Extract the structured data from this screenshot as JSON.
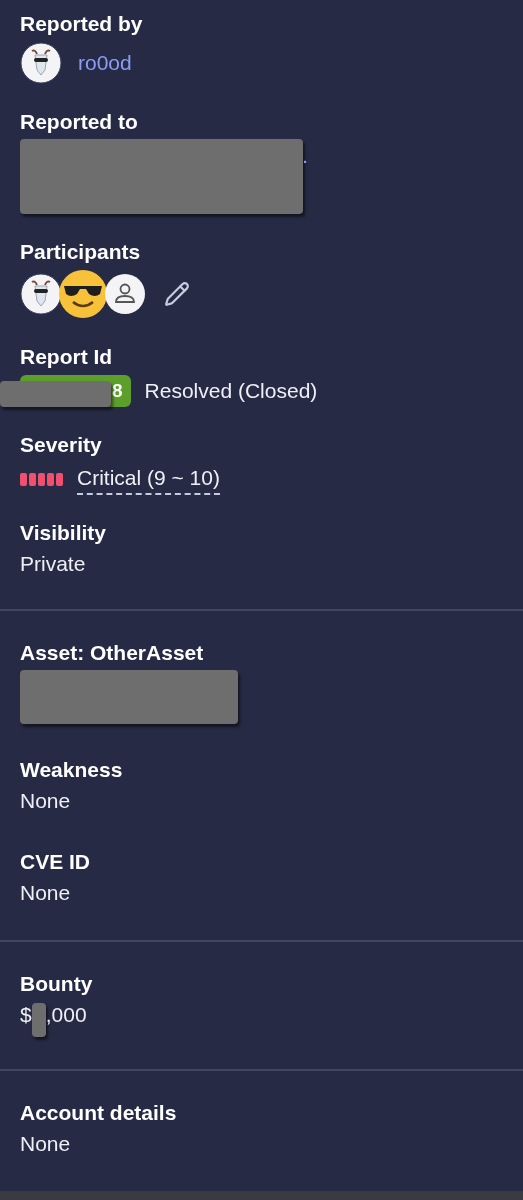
{
  "groups": [
    {
      "fields": [
        {
          "kind": "user",
          "label": "Reported by",
          "value": "ro0od"
        },
        {
          "kind": "redacted-link",
          "label": "Reported to",
          "value": "."
        },
        {
          "kind": "participants",
          "label": "Participants",
          "avatars": [
            {
              "kind": "goat"
            },
            {
              "kind": "emoji"
            },
            {
              "kind": "person"
            }
          ]
        },
        {
          "kind": "report-id",
          "label": "Report Id",
          "badge": "8",
          "value": "Resolved (Closed)"
        },
        {
          "kind": "severity",
          "label": "Severity",
          "level": 1,
          "value": "Critical (9 ~ 10)",
          "color": "#f0506e"
        },
        {
          "kind": "text",
          "label": "Visibility",
          "value": "Private"
        }
      ]
    },
    {
      "fields": [
        {
          "kind": "redacted",
          "label": "Asset: OtherAsset"
        },
        {
          "kind": "text",
          "label": "Weakness",
          "value": "None"
        },
        {
          "kind": "text",
          "label": "CVE ID",
          "value": "None"
        }
      ]
    },
    {
      "fields": [
        {
          "kind": "bounty",
          "label": "Bounty",
          "prefix": "$",
          "value": ",000"
        }
      ]
    },
    {
      "fields": [
        {
          "kind": "text",
          "label": "Account details",
          "value": "None"
        }
      ]
    }
  ]
}
